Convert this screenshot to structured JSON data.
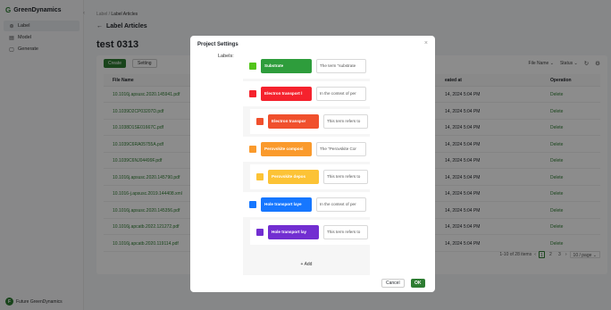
{
  "app": {
    "name": "GreenDynamics",
    "user": "Future GreenDynamics",
    "user_initial": "F"
  },
  "sidebar": {
    "items": [
      {
        "label": "Label",
        "icon": "label-icon",
        "active": true
      },
      {
        "label": "Model",
        "icon": "model-icon",
        "active": false
      },
      {
        "label": "Generate",
        "icon": "generate-icon",
        "active": false
      }
    ]
  },
  "breadcrumb": {
    "root": "Label",
    "separator": "/",
    "current": "Label Articles"
  },
  "header": {
    "back_title": "Label Articles",
    "project_title": "test 0313"
  },
  "toolbar": {
    "create": "Create",
    "setting": "Setting",
    "file_name": "File Name",
    "status": "Status"
  },
  "table": {
    "headers": {
      "file": "File Name",
      "created": "eated at",
      "operation": "Operation"
    },
    "rows": [
      {
        "file": "10.1016j.apsusc.2020.145941.pdf",
        "created": "14, 2024 5:04 PM",
        "op": "Delete"
      },
      {
        "file": "10.1039D2CP03207D.pdf",
        "created": "14, 2024 5:04 PM",
        "op": "Delete"
      },
      {
        "file": "10.1038D1SE01667C.pdf",
        "created": "14, 2024 5:04 PM",
        "op": "Delete"
      },
      {
        "file": "10.1039C6RA05755A.pdf",
        "created": "14, 2024 5:04 PM",
        "op": "Delete"
      },
      {
        "file": "10.1039C6NJ04499F.pdf",
        "created": "14, 2024 5:04 PM",
        "op": "Delete"
      },
      {
        "file": "10.1016j.apsusc.2020.145790.pdf",
        "created": "14, 2024 5:04 PM",
        "op": "Delete"
      },
      {
        "file": "10.1016-j.apsusc.2019.144408.xml",
        "created": "14, 2024 5:04 PM",
        "op": "Delete"
      },
      {
        "file": "10.1016j.apsusc.2020.145356.pdf",
        "created": "14, 2024 5:04 PM",
        "op": "Delete"
      },
      {
        "file": "10.1016j.apcatb.2022.121272.pdf",
        "created": "14, 2024 5:04 PM",
        "op": "Delete"
      },
      {
        "file": "10.1016j.apcatb.2020.119114.pdf",
        "created": "14, 2024 5:04 PM",
        "op": "Delete"
      }
    ]
  },
  "pagination": {
    "summary": "1-10 of 28 items",
    "pages": [
      "1",
      "2",
      "3"
    ],
    "current": "1",
    "page_size": "10 / page"
  },
  "modal": {
    "title": "Project Settings",
    "labels_label": "Labels:",
    "labels": [
      {
        "name": "Substrate",
        "description": "The term \"substrate",
        "color": "#2e9d3c",
        "swatch": "#52c41a",
        "indent": 0
      },
      {
        "name": "Electron transport l",
        "description": "In the context of per",
        "color": "#f5222d",
        "swatch": "#f5222d",
        "indent": 0
      },
      {
        "name": "Electron transpor",
        "description": "This term refers to",
        "color": "#f0502d",
        "swatch": "#f0502d",
        "indent": 1
      },
      {
        "name": "Perovskite composi",
        "description": "The \"Perovskite Cor",
        "color": "#fa9a2c",
        "swatch": "#fa9a2c",
        "indent": 0
      },
      {
        "name": "Perovskite depos",
        "description": "This term refers to",
        "color": "#fcc336",
        "swatch": "#fcc336",
        "indent": 1
      },
      {
        "name": "Hole transport laye",
        "description": "In the context of per",
        "color": "#1677ff",
        "swatch": "#1677ff",
        "indent": 0
      },
      {
        "name": "Hole transport lay",
        "description": "This term refers to",
        "color": "#722ed1",
        "swatch": "#722ed1",
        "indent": 1
      }
    ],
    "add": "+ Add",
    "cancel": "Cancel",
    "ok": "OK"
  }
}
